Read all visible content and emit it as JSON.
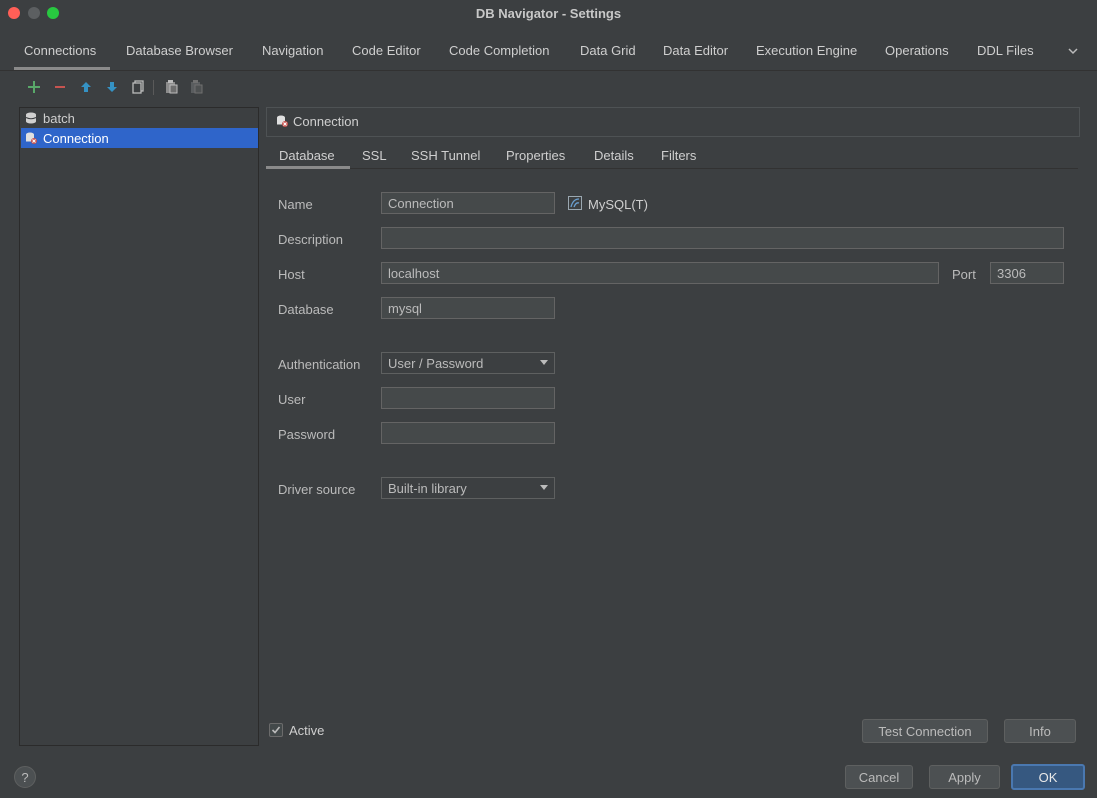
{
  "window": {
    "title": "DB Navigator - Settings"
  },
  "top_tabs": [
    "Connections",
    "Database Browser",
    "Navigation",
    "Code Editor",
    "Code Completion",
    "Data Grid",
    "Data Editor",
    "Execution Engine",
    "Operations",
    "DDL Files"
  ],
  "toolbar": {
    "icons": [
      "add-icon",
      "remove-icon",
      "move-up-icon",
      "move-down-icon",
      "copy-icon",
      "paste-icon",
      "delete-icon"
    ]
  },
  "connections": [
    {
      "label": "batch",
      "selected": false
    },
    {
      "label": "Connection",
      "selected": true
    }
  ],
  "panel": {
    "header": "Connection",
    "tabs": [
      "Database",
      "SSL",
      "SSH Tunnel",
      "Properties",
      "Details",
      "Filters"
    ],
    "form": {
      "name_label": "Name",
      "name_value": "Connection",
      "db_type": "MySQL(T)",
      "description_label": "Description",
      "description_value": "",
      "host_label": "Host",
      "host_value": "localhost",
      "port_label": "Port",
      "port_value": "3306",
      "database_label": "Database",
      "database_value": "mysql",
      "auth_label": "Authentication",
      "auth_value": "User / Password",
      "user_label": "User",
      "user_value": "",
      "password_label": "Password",
      "password_value": "",
      "driver_label": "Driver source",
      "driver_value": "Built-in library"
    },
    "active_label": "Active",
    "active_checked": true,
    "test_button": "Test Connection",
    "info_button": "Info"
  },
  "footer": {
    "help": "?",
    "cancel": "Cancel",
    "apply": "Apply",
    "ok": "OK"
  },
  "colors": {
    "background": "#3c3f41",
    "selection": "#2f65ca",
    "ok_button": "#365880",
    "add_green": "#59a869",
    "remove_red": "#c75450",
    "arrow_blue": "#3592c4"
  }
}
